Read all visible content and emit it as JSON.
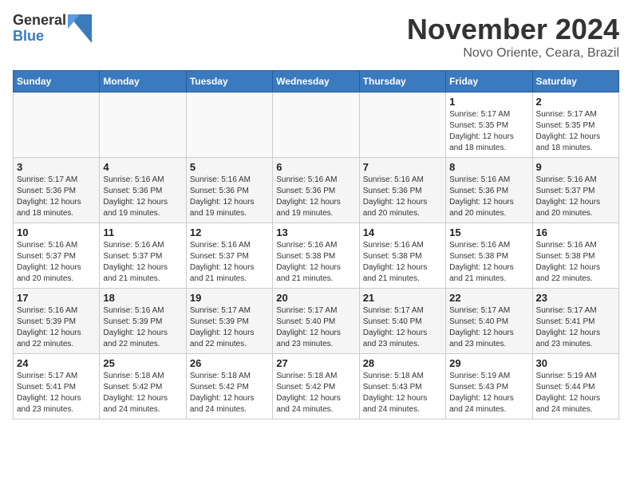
{
  "logo": {
    "general": "General",
    "blue": "Blue"
  },
  "title": "November 2024",
  "location": "Novo Oriente, Ceara, Brazil",
  "days_of_week": [
    "Sunday",
    "Monday",
    "Tuesday",
    "Wednesday",
    "Thursday",
    "Friday",
    "Saturday"
  ],
  "weeks": [
    [
      {
        "day": "",
        "info": ""
      },
      {
        "day": "",
        "info": ""
      },
      {
        "day": "",
        "info": ""
      },
      {
        "day": "",
        "info": ""
      },
      {
        "day": "",
        "info": ""
      },
      {
        "day": "1",
        "info": "Sunrise: 5:17 AM\nSunset: 5:35 PM\nDaylight: 12 hours and 18 minutes."
      },
      {
        "day": "2",
        "info": "Sunrise: 5:17 AM\nSunset: 5:35 PM\nDaylight: 12 hours and 18 minutes."
      }
    ],
    [
      {
        "day": "3",
        "info": "Sunrise: 5:17 AM\nSunset: 5:36 PM\nDaylight: 12 hours and 18 minutes."
      },
      {
        "day": "4",
        "info": "Sunrise: 5:16 AM\nSunset: 5:36 PM\nDaylight: 12 hours and 19 minutes."
      },
      {
        "day": "5",
        "info": "Sunrise: 5:16 AM\nSunset: 5:36 PM\nDaylight: 12 hours and 19 minutes."
      },
      {
        "day": "6",
        "info": "Sunrise: 5:16 AM\nSunset: 5:36 PM\nDaylight: 12 hours and 19 minutes."
      },
      {
        "day": "7",
        "info": "Sunrise: 5:16 AM\nSunset: 5:36 PM\nDaylight: 12 hours and 20 minutes."
      },
      {
        "day": "8",
        "info": "Sunrise: 5:16 AM\nSunset: 5:36 PM\nDaylight: 12 hours and 20 minutes."
      },
      {
        "day": "9",
        "info": "Sunrise: 5:16 AM\nSunset: 5:37 PM\nDaylight: 12 hours and 20 minutes."
      }
    ],
    [
      {
        "day": "10",
        "info": "Sunrise: 5:16 AM\nSunset: 5:37 PM\nDaylight: 12 hours and 20 minutes."
      },
      {
        "day": "11",
        "info": "Sunrise: 5:16 AM\nSunset: 5:37 PM\nDaylight: 12 hours and 21 minutes."
      },
      {
        "day": "12",
        "info": "Sunrise: 5:16 AM\nSunset: 5:37 PM\nDaylight: 12 hours and 21 minutes."
      },
      {
        "day": "13",
        "info": "Sunrise: 5:16 AM\nSunset: 5:38 PM\nDaylight: 12 hours and 21 minutes."
      },
      {
        "day": "14",
        "info": "Sunrise: 5:16 AM\nSunset: 5:38 PM\nDaylight: 12 hours and 21 minutes."
      },
      {
        "day": "15",
        "info": "Sunrise: 5:16 AM\nSunset: 5:38 PM\nDaylight: 12 hours and 21 minutes."
      },
      {
        "day": "16",
        "info": "Sunrise: 5:16 AM\nSunset: 5:38 PM\nDaylight: 12 hours and 22 minutes."
      }
    ],
    [
      {
        "day": "17",
        "info": "Sunrise: 5:16 AM\nSunset: 5:39 PM\nDaylight: 12 hours and 22 minutes."
      },
      {
        "day": "18",
        "info": "Sunrise: 5:16 AM\nSunset: 5:39 PM\nDaylight: 12 hours and 22 minutes."
      },
      {
        "day": "19",
        "info": "Sunrise: 5:17 AM\nSunset: 5:39 PM\nDaylight: 12 hours and 22 minutes."
      },
      {
        "day": "20",
        "info": "Sunrise: 5:17 AM\nSunset: 5:40 PM\nDaylight: 12 hours and 23 minutes."
      },
      {
        "day": "21",
        "info": "Sunrise: 5:17 AM\nSunset: 5:40 PM\nDaylight: 12 hours and 23 minutes."
      },
      {
        "day": "22",
        "info": "Sunrise: 5:17 AM\nSunset: 5:40 PM\nDaylight: 12 hours and 23 minutes."
      },
      {
        "day": "23",
        "info": "Sunrise: 5:17 AM\nSunset: 5:41 PM\nDaylight: 12 hours and 23 minutes."
      }
    ],
    [
      {
        "day": "24",
        "info": "Sunrise: 5:17 AM\nSunset: 5:41 PM\nDaylight: 12 hours and 23 minutes."
      },
      {
        "day": "25",
        "info": "Sunrise: 5:18 AM\nSunset: 5:42 PM\nDaylight: 12 hours and 24 minutes."
      },
      {
        "day": "26",
        "info": "Sunrise: 5:18 AM\nSunset: 5:42 PM\nDaylight: 12 hours and 24 minutes."
      },
      {
        "day": "27",
        "info": "Sunrise: 5:18 AM\nSunset: 5:42 PM\nDaylight: 12 hours and 24 minutes."
      },
      {
        "day": "28",
        "info": "Sunrise: 5:18 AM\nSunset: 5:43 PM\nDaylight: 12 hours and 24 minutes."
      },
      {
        "day": "29",
        "info": "Sunrise: 5:19 AM\nSunset: 5:43 PM\nDaylight: 12 hours and 24 minutes."
      },
      {
        "day": "30",
        "info": "Sunrise: 5:19 AM\nSunset: 5:44 PM\nDaylight: 12 hours and 24 minutes."
      }
    ]
  ]
}
